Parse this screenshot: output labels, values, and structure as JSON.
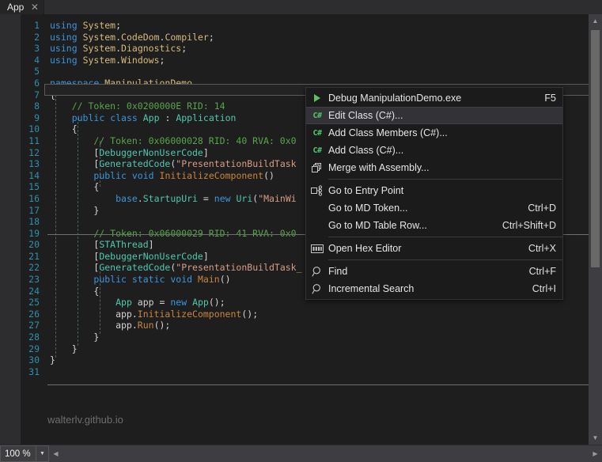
{
  "window": {
    "title": "App",
    "watermark": "walterlv.github.io"
  },
  "tabs": [
    {
      "label": "App",
      "close_icon": "close-icon"
    }
  ],
  "editor": {
    "line_numbers": [
      1,
      2,
      3,
      4,
      5,
      6,
      7,
      8,
      9,
      10,
      11,
      12,
      13,
      14,
      15,
      16,
      17,
      18,
      19,
      20,
      21,
      22,
      23,
      24,
      25,
      26,
      27,
      28,
      29,
      30,
      31
    ],
    "lines": [
      {
        "n": 1,
        "tokens": [
          {
            "t": "using",
            "c": "kw"
          },
          {
            "t": " ",
            "c": "pun"
          },
          {
            "t": "System",
            "c": "ns"
          },
          {
            "t": ";",
            "c": "pun"
          }
        ]
      },
      {
        "n": 2,
        "tokens": [
          {
            "t": "using",
            "c": "kw"
          },
          {
            "t": " ",
            "c": "pun"
          },
          {
            "t": "System",
            "c": "ns"
          },
          {
            "t": ".",
            "c": "pun"
          },
          {
            "t": "CodeDom",
            "c": "ns"
          },
          {
            "t": ".",
            "c": "pun"
          },
          {
            "t": "Compiler",
            "c": "ns"
          },
          {
            "t": ";",
            "c": "pun"
          }
        ]
      },
      {
        "n": 3,
        "tokens": [
          {
            "t": "using",
            "c": "kw"
          },
          {
            "t": " ",
            "c": "pun"
          },
          {
            "t": "System",
            "c": "ns"
          },
          {
            "t": ".",
            "c": "pun"
          },
          {
            "t": "Diagnostics",
            "c": "ns"
          },
          {
            "t": ";",
            "c": "pun"
          }
        ]
      },
      {
        "n": 4,
        "tokens": [
          {
            "t": "using",
            "c": "kw"
          },
          {
            "t": " ",
            "c": "pun"
          },
          {
            "t": "System",
            "c": "ns"
          },
          {
            "t": ".",
            "c": "pun"
          },
          {
            "t": "Windows",
            "c": "ns"
          },
          {
            "t": ";",
            "c": "pun"
          }
        ]
      },
      {
        "n": 5,
        "tokens": []
      },
      {
        "n": 6,
        "tokens": [
          {
            "t": "namespace",
            "c": "kw"
          },
          {
            "t": " ",
            "c": "pun"
          },
          {
            "t": "ManipulationDemo",
            "c": "ns"
          }
        ]
      },
      {
        "n": 7,
        "tokens": [
          {
            "t": "{",
            "c": "pun"
          }
        ]
      },
      {
        "n": 8,
        "tokens": [
          {
            "t": "    // Token: 0x0200000E RID: 14",
            "c": "cmt"
          }
        ]
      },
      {
        "n": 9,
        "tokens": [
          {
            "t": "    ",
            "c": "pun"
          },
          {
            "t": "public",
            "c": "kw"
          },
          {
            "t": " ",
            "c": "pun"
          },
          {
            "t": "class",
            "c": "kw"
          },
          {
            "t": " ",
            "c": "pun"
          },
          {
            "t": "App",
            "c": "typ"
          },
          {
            "t": " : ",
            "c": "pun"
          },
          {
            "t": "Application",
            "c": "typ"
          }
        ]
      },
      {
        "n": 10,
        "tokens": [
          {
            "t": "    {",
            "c": "pun"
          }
        ]
      },
      {
        "n": 11,
        "tokens": [
          {
            "t": "        // Token: 0x06000028 RID: 40 RVA: 0x0",
            "c": "cmt"
          }
        ]
      },
      {
        "n": 12,
        "tokens": [
          {
            "t": "        [",
            "c": "pun"
          },
          {
            "t": "DebuggerNonUserCode",
            "c": "attr"
          },
          {
            "t": "]",
            "c": "pun"
          }
        ]
      },
      {
        "n": 13,
        "tokens": [
          {
            "t": "        [",
            "c": "pun"
          },
          {
            "t": "GeneratedCode",
            "c": "attr"
          },
          {
            "t": "(",
            "c": "pun"
          },
          {
            "t": "\"PresentationBuildTask",
            "c": "str"
          }
        ]
      },
      {
        "n": 14,
        "tokens": [
          {
            "t": "        ",
            "c": "pun"
          },
          {
            "t": "public",
            "c": "kw"
          },
          {
            "t": " ",
            "c": "pun"
          },
          {
            "t": "void",
            "c": "kw"
          },
          {
            "t": " ",
            "c": "pun"
          },
          {
            "t": "InitializeComponent",
            "c": "orange"
          },
          {
            "t": "()",
            "c": "pun"
          }
        ]
      },
      {
        "n": 15,
        "tokens": [
          {
            "t": "        {",
            "c": "pun"
          }
        ]
      },
      {
        "n": 16,
        "tokens": [
          {
            "t": "            ",
            "c": "pun"
          },
          {
            "t": "base",
            "c": "kw"
          },
          {
            "t": ".",
            "c": "pun"
          },
          {
            "t": "StartupUri",
            "c": "typ"
          },
          {
            "t": " = ",
            "c": "pun"
          },
          {
            "t": "new",
            "c": "kw"
          },
          {
            "t": " ",
            "c": "pun"
          },
          {
            "t": "Uri",
            "c": "typ"
          },
          {
            "t": "(",
            "c": "pun"
          },
          {
            "t": "\"MainWi",
            "c": "str"
          }
        ]
      },
      {
        "n": 17,
        "tokens": [
          {
            "t": "        }",
            "c": "pun"
          }
        ]
      },
      {
        "n": 18,
        "tokens": []
      },
      {
        "n": 19,
        "tokens": [
          {
            "t": "        // Token: 0x06000029 RID: 41 RVA: 0x0",
            "c": "cmt"
          }
        ]
      },
      {
        "n": 20,
        "tokens": [
          {
            "t": "        [",
            "c": "pun"
          },
          {
            "t": "STAThread",
            "c": "attr"
          },
          {
            "t": "]",
            "c": "pun"
          }
        ]
      },
      {
        "n": 21,
        "tokens": [
          {
            "t": "        [",
            "c": "pun"
          },
          {
            "t": "DebuggerNonUserCode",
            "c": "attr"
          },
          {
            "t": "]",
            "c": "pun"
          }
        ]
      },
      {
        "n": 22,
        "tokens": [
          {
            "t": "        [",
            "c": "pun"
          },
          {
            "t": "GeneratedCode",
            "c": "attr"
          },
          {
            "t": "(",
            "c": "pun"
          },
          {
            "t": "\"PresentationBuildTask_",
            "c": "str"
          }
        ]
      },
      {
        "n": 23,
        "tokens": [
          {
            "t": "        ",
            "c": "pun"
          },
          {
            "t": "public",
            "c": "kw"
          },
          {
            "t": " ",
            "c": "pun"
          },
          {
            "t": "static",
            "c": "kw"
          },
          {
            "t": " ",
            "c": "pun"
          },
          {
            "t": "void",
            "c": "kw"
          },
          {
            "t": " ",
            "c": "pun"
          },
          {
            "t": "Main",
            "c": "orange"
          },
          {
            "t": "()",
            "c": "pun"
          }
        ]
      },
      {
        "n": 24,
        "tokens": [
          {
            "t": "        {",
            "c": "pun"
          }
        ]
      },
      {
        "n": 25,
        "tokens": [
          {
            "t": "            ",
            "c": "pun"
          },
          {
            "t": "App",
            "c": "typ"
          },
          {
            "t": " app = ",
            "c": "pun"
          },
          {
            "t": "new",
            "c": "kw"
          },
          {
            "t": " ",
            "c": "pun"
          },
          {
            "t": "App",
            "c": "typ"
          },
          {
            "t": "();",
            "c": "pun"
          }
        ]
      },
      {
        "n": 26,
        "tokens": [
          {
            "t": "            app.",
            "c": "pun"
          },
          {
            "t": "InitializeComponent",
            "c": "orange"
          },
          {
            "t": "();",
            "c": "pun"
          }
        ]
      },
      {
        "n": 27,
        "tokens": [
          {
            "t": "            app.",
            "c": "pun"
          },
          {
            "t": "Run",
            "c": "orange"
          },
          {
            "t": "();",
            "c": "pun"
          }
        ]
      },
      {
        "n": 28,
        "tokens": [
          {
            "t": "        }",
            "c": "pun"
          }
        ]
      },
      {
        "n": 29,
        "tokens": [
          {
            "t": "    }",
            "c": "pun"
          }
        ]
      },
      {
        "n": 30,
        "tokens": [
          {
            "t": "}",
            "c": "pun"
          }
        ]
      },
      {
        "n": 31,
        "tokens": []
      }
    ]
  },
  "context_menu": {
    "items": [
      {
        "icon": "play-icon",
        "label": "Debug ManipulationDemo.exe",
        "shortcut": "F5",
        "selected": false,
        "separator_after": false
      },
      {
        "icon": "csharp-icon",
        "label": "Edit Class (C#)...",
        "shortcut": "",
        "selected": true,
        "separator_after": false
      },
      {
        "icon": "csharp-icon",
        "label": "Add Class Members (C#)...",
        "shortcut": "",
        "selected": false,
        "separator_after": false
      },
      {
        "icon": "csharp-icon",
        "label": "Add Class (C#)...",
        "shortcut": "",
        "selected": false,
        "separator_after": false
      },
      {
        "icon": "merge-icon",
        "label": "Merge with Assembly...",
        "shortcut": "",
        "selected": false,
        "separator_after": true
      },
      {
        "icon": "entrypoint-icon",
        "label": "Go to Entry Point",
        "shortcut": "",
        "selected": false,
        "separator_after": false
      },
      {
        "icon": "",
        "label": "Go to MD Token...",
        "shortcut": "Ctrl+D",
        "selected": false,
        "separator_after": false
      },
      {
        "icon": "",
        "label": "Go to MD Table Row...",
        "shortcut": "Ctrl+Shift+D",
        "selected": false,
        "separator_after": true
      },
      {
        "icon": "hex-icon",
        "label": "Open Hex Editor",
        "shortcut": "Ctrl+X",
        "selected": false,
        "separator_after": true
      },
      {
        "icon": "search-icon",
        "label": "Find",
        "shortcut": "Ctrl+F",
        "selected": false,
        "separator_after": false
      },
      {
        "icon": "search-icon",
        "label": "Incremental Search",
        "shortcut": "Ctrl+I",
        "selected": false,
        "separator_after": false
      }
    ]
  },
  "status_bar": {
    "zoom_value": "100 %",
    "zoom_dropdown_icon": "chevron-down-icon",
    "hscroll_left_icon": "chevron-left-icon",
    "hscroll_right_icon": "chevron-right-icon"
  },
  "scrollbar": {
    "up_icon": "chevron-up-icon",
    "down_icon": "chevron-down-icon"
  },
  "colors": {
    "background": "#1e1e1e",
    "chrome": "#2d2d30",
    "accent_blue": "#3a96dd",
    "line_number": "#2b91af",
    "comment_green": "#57a64a",
    "string_orange": "#d69d85",
    "type_teal": "#4ec9b0",
    "menu_bg": "#1b1b1c",
    "menu_selected": "#333337",
    "statusbar": "#3e3e42"
  }
}
